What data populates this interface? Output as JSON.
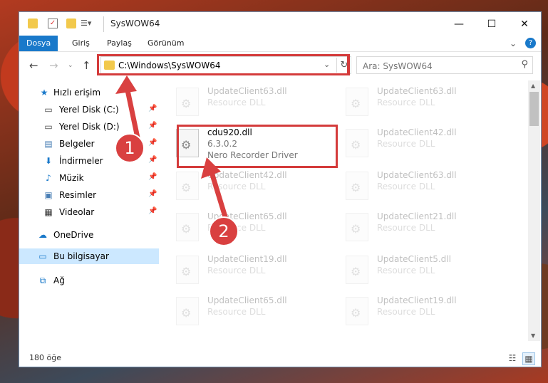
{
  "window": {
    "title": "SysWOW64",
    "minimize": "—",
    "maximize": "☐",
    "close": "✕",
    "help": "?",
    "ribbon_expand": "⌄"
  },
  "ribbon": {
    "tabs": [
      {
        "label": "Dosya",
        "active": true
      },
      {
        "label": "Giriş"
      },
      {
        "label": "Paylaş"
      },
      {
        "label": "Görünüm"
      }
    ]
  },
  "address": {
    "path": "C:\\Windows\\SysWOW64",
    "search_placeholder": "Ara: SysWOW64"
  },
  "nav": {
    "items": [
      {
        "label": "Hızlı erişim",
        "icon": "star-icon",
        "pinned": false
      },
      {
        "label": "Yerel Disk (C:)",
        "icon": "drive-icon",
        "pinned": true
      },
      {
        "label": "Yerel Disk (D:)",
        "icon": "drive-icon",
        "pinned": true
      },
      {
        "label": "Belgeler",
        "icon": "documents-icon",
        "pinned": true
      },
      {
        "label": "İndirmeler",
        "icon": "download-icon",
        "pinned": true
      },
      {
        "label": "Müzik",
        "icon": "music-icon",
        "pinned": true
      },
      {
        "label": "Resimler",
        "icon": "pictures-icon",
        "pinned": true
      },
      {
        "label": "Videolar",
        "icon": "videos-icon",
        "pinned": true
      },
      {
        "label": "OneDrive",
        "icon": "cloud-icon",
        "pinned": false
      },
      {
        "label": "Bu bilgisayar",
        "icon": "computer-icon",
        "pinned": false,
        "selected": true
      },
      {
        "label": "Ağ",
        "icon": "network-icon",
        "pinned": false
      }
    ]
  },
  "files": {
    "left": [
      {
        "name": "UpdateClient63.dll",
        "desc": "Resource DLL"
      },
      {
        "name": "cdu920.dll",
        "version": "6.3.0.2",
        "desc": "Nero Recorder Driver",
        "highlighted": true
      },
      {
        "name": "UpdateClient42.dll",
        "desc": "Resource DLL"
      },
      {
        "name": "UpdateClient65.dll",
        "desc": "Resource DLL"
      },
      {
        "name": "UpdateClient19.dll",
        "desc": "Resource DLL"
      },
      {
        "name": "UpdateClient65.dll",
        "desc": "Resource DLL"
      }
    ],
    "right": [
      {
        "name": "UpdateClient63.dll",
        "desc": "Resource DLL"
      },
      {
        "name": "UpdateClient42.dll",
        "desc": "Resource DLL"
      },
      {
        "name": "UpdateClient63.dll",
        "desc": "Resource DLL"
      },
      {
        "name": "UpdateClient21.dll",
        "desc": "Resource DLL"
      },
      {
        "name": "UpdateClient5.dll",
        "desc": "Resource DLL"
      },
      {
        "name": "UpdateClient19.dll",
        "desc": "Resource DLL"
      }
    ]
  },
  "status": {
    "count": "180 öğe"
  },
  "callouts": {
    "one": "1",
    "two": "2"
  },
  "colors": {
    "accent": "#1979ca",
    "highlight": "#d43b3b",
    "selected_nav": "#cce8ff"
  }
}
